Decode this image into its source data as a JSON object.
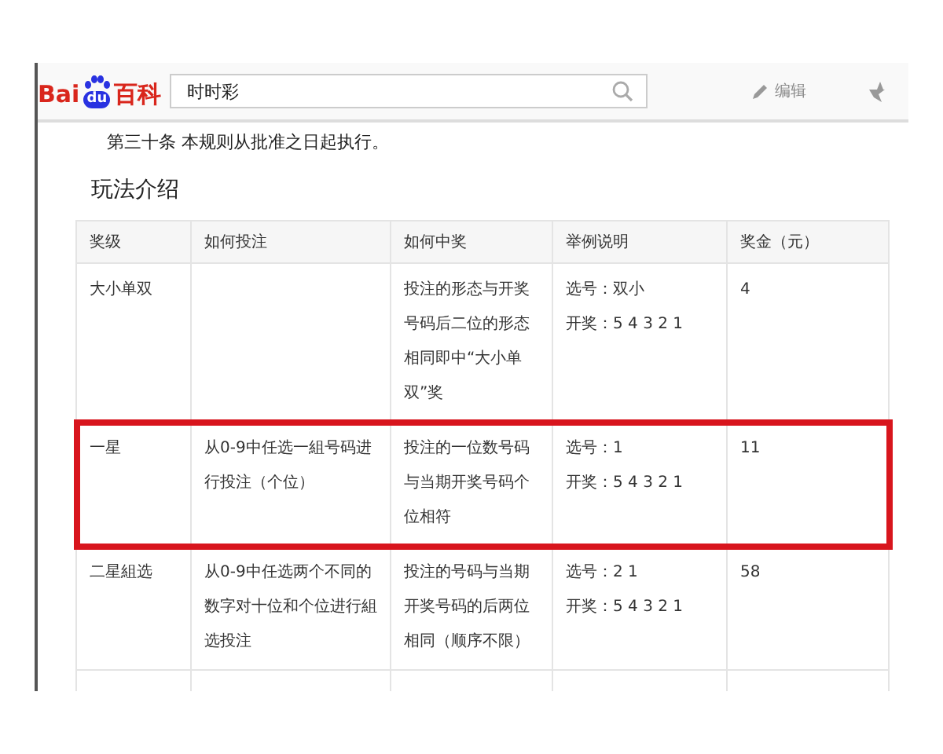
{
  "header": {
    "logo": {
      "part_1": "Bai",
      "part_2": "du",
      "part_3": "百科"
    },
    "search": {
      "value": "时时彩"
    },
    "edit_link": "编辑"
  },
  "article": {
    "paragraph": "第三十条 本规则从批准之日起执行。",
    "heading": "玩法介绍",
    "table": {
      "columns": [
        "奖级",
        "如何投注",
        "如何中奖",
        "举例说明",
        "奖金（元）"
      ],
      "rows": [
        {
          "highlighted": false,
          "cells": [
            "大小单双",
            "",
            "投注的形态与开奖号码后二位的形态相同即中“大小单双”奖",
            [
              "选号：双小",
              "开奖：5 4 3 2 1"
            ],
            "4"
          ]
        },
        {
          "highlighted": true,
          "cells": [
            "一星",
            "从0-9中任选一組号码进行投注（个位）",
            "投注的一位数号码与当期开奖号码个位相符",
            [
              "选号：1",
              "开奖：5 4 3 2 1"
            ],
            "11"
          ]
        },
        {
          "highlighted": false,
          "cells": [
            "二星組选",
            "从0-9中任选两个不同的数字对十位和个位进行組选投注",
            "投注的号码与当期开奖号码的后两位相同（顺序不限）",
            [
              "选号：2 1",
              "开奖：5 4 3 2 1"
            ],
            "58"
          ]
        }
      ]
    }
  }
}
